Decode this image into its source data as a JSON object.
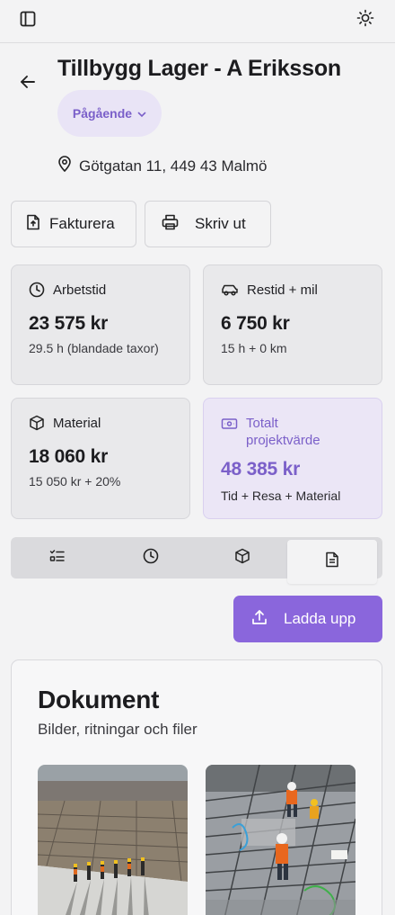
{
  "header": {
    "sidebar_icon": "sidebar-toggle-icon",
    "theme_icon": "sun-icon"
  },
  "project": {
    "title": "Tillbygg Lager - A Eriksson",
    "status": "Pågående",
    "address": "Götgatan 11, 449 43 Malmö"
  },
  "actions": {
    "invoice_label": "Fakturera",
    "print_label": "Skriv ut"
  },
  "cards": {
    "work": {
      "label": "Arbetstid",
      "amount": "23 575 kr",
      "sub": "29.5 h (blandade taxor)"
    },
    "travel": {
      "label": "Restid + mil",
      "amount": "6 750 kr",
      "sub": "15 h + 0 km"
    },
    "material": {
      "label": "Material",
      "amount": "18 060 kr",
      "sub": "15 050 kr + 20%"
    },
    "total": {
      "label": "Totalt projektvärde",
      "amount": "48 385 kr",
      "sub": "Tid + Resa + Material"
    }
  },
  "tabs": [
    {
      "icon": "checklist-icon"
    },
    {
      "icon": "clock-icon"
    },
    {
      "icon": "package-icon"
    },
    {
      "icon": "document-icon",
      "active": true
    }
  ],
  "upload": {
    "label": "Ladda upp"
  },
  "documents": {
    "title": "Dokument",
    "subtitle": "Bilder, ritningar och filer"
  },
  "colors": {
    "accent": "#8a66dc",
    "accent_text": "#7b60c9",
    "accent_bg": "#ebe6f6",
    "background": "#f3f3f4"
  }
}
